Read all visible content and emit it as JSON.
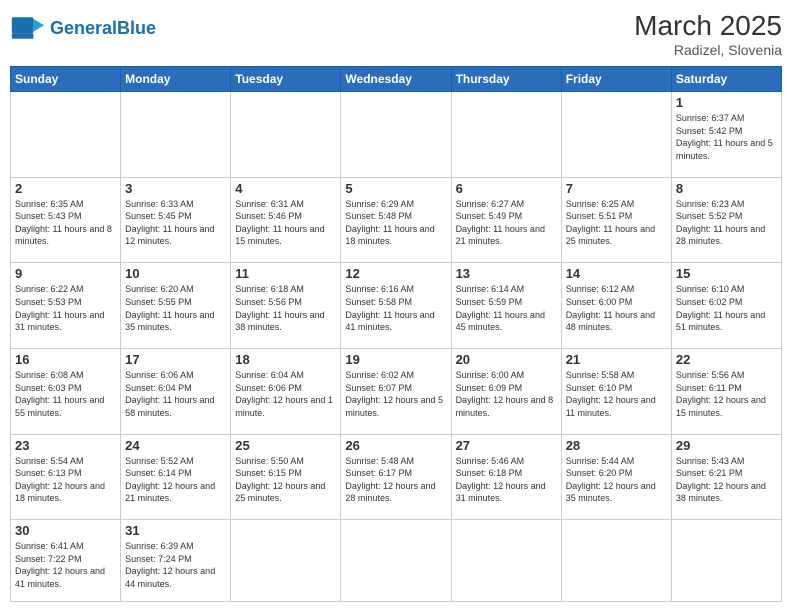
{
  "header": {
    "logo_general": "General",
    "logo_blue": "Blue",
    "month_year": "March 2025",
    "location": "Radizel, Slovenia"
  },
  "weekdays": [
    "Sunday",
    "Monday",
    "Tuesday",
    "Wednesday",
    "Thursday",
    "Friday",
    "Saturday"
  ],
  "weeks": [
    [
      {
        "day": "",
        "content": ""
      },
      {
        "day": "",
        "content": ""
      },
      {
        "day": "",
        "content": ""
      },
      {
        "day": "",
        "content": ""
      },
      {
        "day": "",
        "content": ""
      },
      {
        "day": "",
        "content": ""
      },
      {
        "day": "1",
        "content": "Sunrise: 6:37 AM\nSunset: 5:42 PM\nDaylight: 11 hours\nand 5 minutes."
      }
    ],
    [
      {
        "day": "2",
        "content": "Sunrise: 6:35 AM\nSunset: 5:43 PM\nDaylight: 11 hours\nand 8 minutes."
      },
      {
        "day": "3",
        "content": "Sunrise: 6:33 AM\nSunset: 5:45 PM\nDaylight: 11 hours\nand 12 minutes."
      },
      {
        "day": "4",
        "content": "Sunrise: 6:31 AM\nSunset: 5:46 PM\nDaylight: 11 hours\nand 15 minutes."
      },
      {
        "day": "5",
        "content": "Sunrise: 6:29 AM\nSunset: 5:48 PM\nDaylight: 11 hours\nand 18 minutes."
      },
      {
        "day": "6",
        "content": "Sunrise: 6:27 AM\nSunset: 5:49 PM\nDaylight: 11 hours\nand 21 minutes."
      },
      {
        "day": "7",
        "content": "Sunrise: 6:25 AM\nSunset: 5:51 PM\nDaylight: 11 hours\nand 25 minutes."
      },
      {
        "day": "8",
        "content": "Sunrise: 6:23 AM\nSunset: 5:52 PM\nDaylight: 11 hours\nand 28 minutes."
      }
    ],
    [
      {
        "day": "9",
        "content": "Sunrise: 6:22 AM\nSunset: 5:53 PM\nDaylight: 11 hours\nand 31 minutes."
      },
      {
        "day": "10",
        "content": "Sunrise: 6:20 AM\nSunset: 5:55 PM\nDaylight: 11 hours\nand 35 minutes."
      },
      {
        "day": "11",
        "content": "Sunrise: 6:18 AM\nSunset: 5:56 PM\nDaylight: 11 hours\nand 38 minutes."
      },
      {
        "day": "12",
        "content": "Sunrise: 6:16 AM\nSunset: 5:58 PM\nDaylight: 11 hours\nand 41 minutes."
      },
      {
        "day": "13",
        "content": "Sunrise: 6:14 AM\nSunset: 5:59 PM\nDaylight: 11 hours\nand 45 minutes."
      },
      {
        "day": "14",
        "content": "Sunrise: 6:12 AM\nSunset: 6:00 PM\nDaylight: 11 hours\nand 48 minutes."
      },
      {
        "day": "15",
        "content": "Sunrise: 6:10 AM\nSunset: 6:02 PM\nDaylight: 11 hours\nand 51 minutes."
      }
    ],
    [
      {
        "day": "16",
        "content": "Sunrise: 6:08 AM\nSunset: 6:03 PM\nDaylight: 11 hours\nand 55 minutes."
      },
      {
        "day": "17",
        "content": "Sunrise: 6:06 AM\nSunset: 6:04 PM\nDaylight: 11 hours\nand 58 minutes."
      },
      {
        "day": "18",
        "content": "Sunrise: 6:04 AM\nSunset: 6:06 PM\nDaylight: 12 hours\nand 1 minute."
      },
      {
        "day": "19",
        "content": "Sunrise: 6:02 AM\nSunset: 6:07 PM\nDaylight: 12 hours\nand 5 minutes."
      },
      {
        "day": "20",
        "content": "Sunrise: 6:00 AM\nSunset: 6:09 PM\nDaylight: 12 hours\nand 8 minutes."
      },
      {
        "day": "21",
        "content": "Sunrise: 5:58 AM\nSunset: 6:10 PM\nDaylight: 12 hours\nand 11 minutes."
      },
      {
        "day": "22",
        "content": "Sunrise: 5:56 AM\nSunset: 6:11 PM\nDaylight: 12 hours\nand 15 minutes."
      }
    ],
    [
      {
        "day": "23",
        "content": "Sunrise: 5:54 AM\nSunset: 6:13 PM\nDaylight: 12 hours\nand 18 minutes."
      },
      {
        "day": "24",
        "content": "Sunrise: 5:52 AM\nSunset: 6:14 PM\nDaylight: 12 hours\nand 21 minutes."
      },
      {
        "day": "25",
        "content": "Sunrise: 5:50 AM\nSunset: 6:15 PM\nDaylight: 12 hours\nand 25 minutes."
      },
      {
        "day": "26",
        "content": "Sunrise: 5:48 AM\nSunset: 6:17 PM\nDaylight: 12 hours\nand 28 minutes."
      },
      {
        "day": "27",
        "content": "Sunrise: 5:46 AM\nSunset: 6:18 PM\nDaylight: 12 hours\nand 31 minutes."
      },
      {
        "day": "28",
        "content": "Sunrise: 5:44 AM\nSunset: 6:20 PM\nDaylight: 12 hours\nand 35 minutes."
      },
      {
        "day": "29",
        "content": "Sunrise: 5:43 AM\nSunset: 6:21 PM\nDaylight: 12 hours\nand 38 minutes."
      }
    ],
    [
      {
        "day": "30",
        "content": "Sunrise: 6:41 AM\nSunset: 7:22 PM\nDaylight: 12 hours\nand 41 minutes."
      },
      {
        "day": "31",
        "content": "Sunrise: 6:39 AM\nSunset: 7:24 PM\nDaylight: 12 hours\nand 44 minutes."
      },
      {
        "day": "",
        "content": ""
      },
      {
        "day": "",
        "content": ""
      },
      {
        "day": "",
        "content": ""
      },
      {
        "day": "",
        "content": ""
      },
      {
        "day": "",
        "content": ""
      }
    ]
  ]
}
